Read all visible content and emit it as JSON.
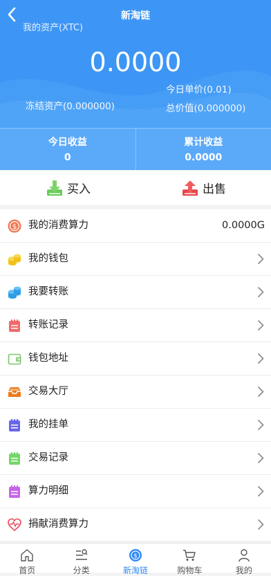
{
  "header": {
    "title": "新淘链",
    "asset_label": "我的资产(XTC)",
    "balance": "0.0000",
    "unit_price": "今日单价(0.01)",
    "frozen": "冻结资产(0.000000)",
    "total_value": "总价值(0.000000)"
  },
  "earnings": [
    {
      "title": "今日收益",
      "value": "0"
    },
    {
      "title": "累计收益",
      "value": "0.0000"
    }
  ],
  "trade": {
    "buy": "买入",
    "sell": "出售"
  },
  "menu": [
    {
      "label": "我的消费算力",
      "value": "0.0000G",
      "icon": "coin-icon"
    },
    {
      "label": "我的钱包",
      "icon": "coins-stack-icon"
    },
    {
      "label": "我要转账",
      "icon": "transfer-coins-icon"
    },
    {
      "label": "转账记录",
      "icon": "record-notebook-icon"
    },
    {
      "label": "钱包地址",
      "icon": "wallet-icon"
    },
    {
      "label": "交易大厅",
      "icon": "trading-hall-icon"
    },
    {
      "label": "我的挂单",
      "icon": "order-notebook-icon"
    },
    {
      "label": "交易记录",
      "icon": "trade-record-icon"
    },
    {
      "label": "算力明细",
      "icon": "detail-notebook-icon"
    },
    {
      "label": "捐献消费算力",
      "icon": "heart-pulse-icon"
    }
  ],
  "tabs": [
    {
      "label": "首页",
      "icon": "home-icon"
    },
    {
      "label": "分类",
      "icon": "category-icon"
    },
    {
      "label": "新淘链",
      "icon": "chain-coin-icon",
      "active": true
    },
    {
      "label": "购物车",
      "icon": "cart-icon"
    },
    {
      "label": "我的",
      "icon": "user-icon"
    }
  ],
  "colors": {
    "primary": "#3d96f5",
    "tab_active": "#2f8af5",
    "buy": "#6ccb5a",
    "sell": "#e8474a"
  }
}
